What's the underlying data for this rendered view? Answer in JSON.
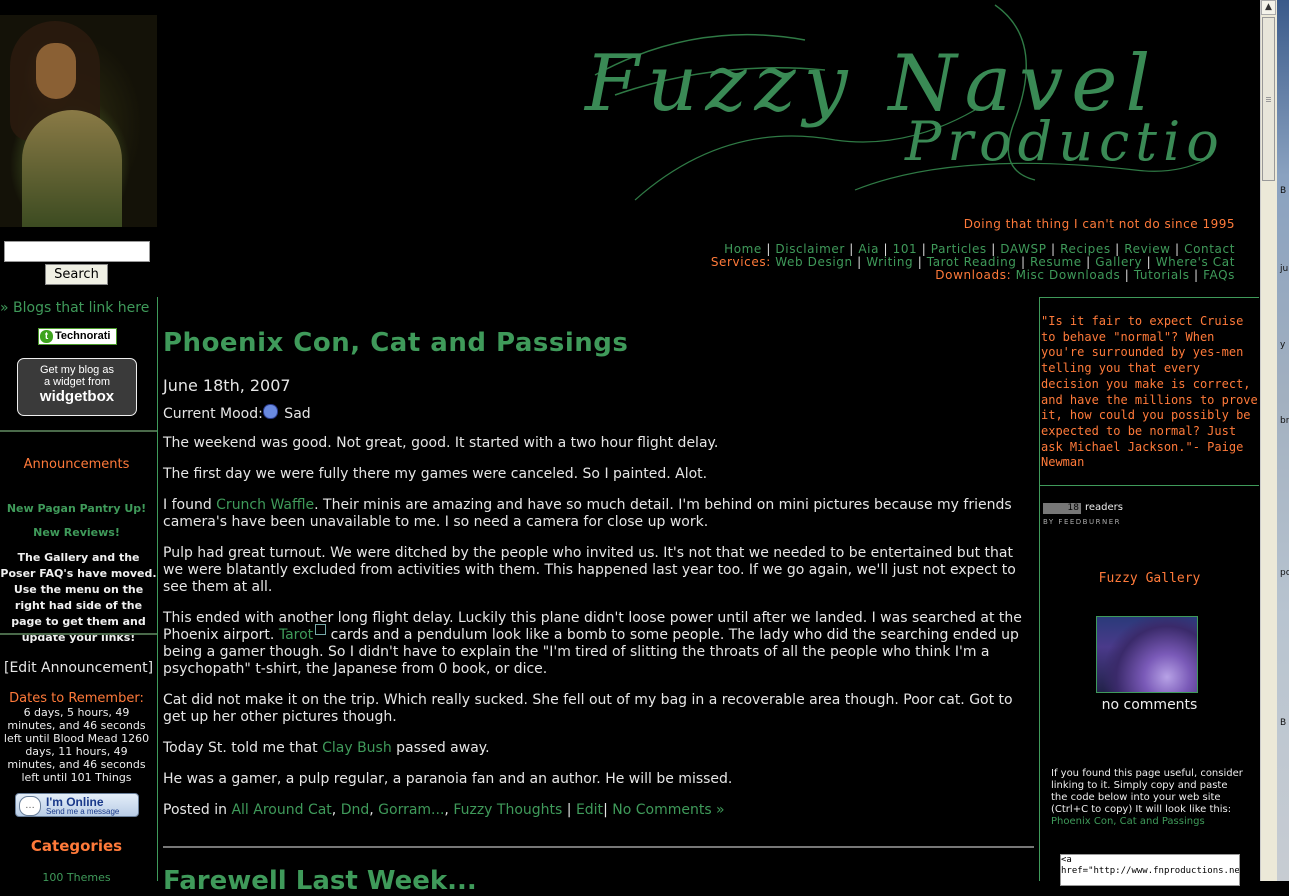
{
  "header": {
    "logo_line1": "Fuzzy Navel",
    "logo_line2": "Productions",
    "tagline": "Doing that thing I can't not do since 1995",
    "nav_main": [
      "Home",
      "Disclaimer",
      "Aia",
      "101",
      "Particles",
      "DAWSP",
      "Recipes",
      "Review",
      "Contact"
    ],
    "services_label": "Services:",
    "services": [
      "Web Design",
      "Writing",
      "Tarot Reading",
      "Resume",
      "Gallery",
      "Where's Cat"
    ],
    "downloads_label": "Downloads:",
    "downloads": [
      "Misc Downloads",
      "Tutorials",
      "FAQs"
    ]
  },
  "sidebar_left": {
    "search_placeholder": "",
    "search_button": "Search",
    "blogs_link": "» Blogs that link here",
    "technorati": "Technorati",
    "widgetbox_line1": "Get my blog as",
    "widgetbox_line2": "a widget from",
    "widgetbox_line3": "widgetbox",
    "announcements_title": "Announcements",
    "announcement_link1": "New Pagan Pantry Up!",
    "announcement_link2": "New Reviews!",
    "announcement_body": "The Gallery and the Poser FAQ's have moved. Use the menu on the right had side of the page to get them and update your links!",
    "edit_announcement": "[Edit Announcement]",
    "dates_title": "Dates to Remember:",
    "dates_body": "6 days, 5 hours, 49 minutes, and 46 seconds left until Blood Mead 1260 days, 11 hours, 49 minutes, and 46 seconds left until 101 Things",
    "im_online_line1": "I'm Online",
    "im_online_line2": "Send me a message",
    "categories_title": "Categories",
    "categories_first": "100 Themes"
  },
  "post": {
    "title": "Phoenix Con, Cat and Passings",
    "date": "June 18th, 2007",
    "mood_label": "Current Mood:",
    "mood_value": " Sad",
    "p1": "The weekend was good. Not great, good. It started with a two hour flight delay.",
    "p2": "The first day we were fully there my games were canceled. So I painted. Alot.",
    "p3_pre": "I found ",
    "p3_link": "Crunch Waffle",
    "p3_post": ". Their minis are amazing and have so much detail. I'm behind on mini pictures because my friends camera's have been unavailable to me. I so need a camera for close up work.",
    "p4": "Pulp had great turnout. We were ditched by the people who invited us. It's not that we needed to be entertained but that we were blatantly excluded from activities with them. This happened last year too. If we go again, we'll just not expect to see them at all.",
    "p5_pre": "This ended with another long flight delay. Luckily this plane didn't loose power until after we landed. I was searched at the Phoenix airport. ",
    "p5_link": "Tarot",
    "p5_post": " cards and a pendulum look like a bomb to some people. The lady who did the searching ended up being a gamer though. So I didn't have to explain the \"I'm tired of slitting the throats of all the people who think I'm a psychopath\" t-shirt, the Japanese from 0 book, or dice.",
    "p6": "Cat did not make it on the trip. Which really sucked. She fell out of my bag in a recoverable area though. Poor cat. Got to get up her other pictures though.",
    "p7_pre": "Today St. told me that ",
    "p7_link": "Clay Bush",
    "p7_post": " passed away.",
    "p8": "He was a gamer, a pulp regular, a paranoia fan and an author. He will be missed.",
    "posted_in": "Posted in ",
    "categories": [
      "All Around Cat",
      "Dnd",
      "Gorram...",
      "Fuzzy Thoughts"
    ],
    "edit": "Edit",
    "comments": "No Comments »",
    "next_title": "Farewell Last Week..."
  },
  "sidebar_right": {
    "quote": "\"Is it fair to expect Cruise to behave \"normal\"? When you're surrounded by yes-men telling you that every decision you make is correct, and have the millions to prove it, how could you possibly be expected to be normal? Just ask Michael Jackson.\"- Paige Newman",
    "feed_count": "18",
    "feed_label": "readers",
    "feed_by": "BY FEEDBURNER",
    "gallery_title": "Fuzzy Gallery",
    "gallery_caption": "no comments",
    "link_info": "If you found this page useful, consider linking to it. Simply copy and paste the code below into your web site (Ctrl+C to copy) It will look like this: ",
    "link_example": "Phoenix Con, Cat and Passings",
    "code_box": "<a\nhref=\"http://www.fnproductions.net"
  },
  "desktop_labels": [
    "B",
    "ju",
    "y",
    "br",
    "pc",
    "B"
  ],
  "colors": {
    "accent_green": "#3f9a5a",
    "accent_orange": "#ff7a3a",
    "background": "#000000"
  }
}
